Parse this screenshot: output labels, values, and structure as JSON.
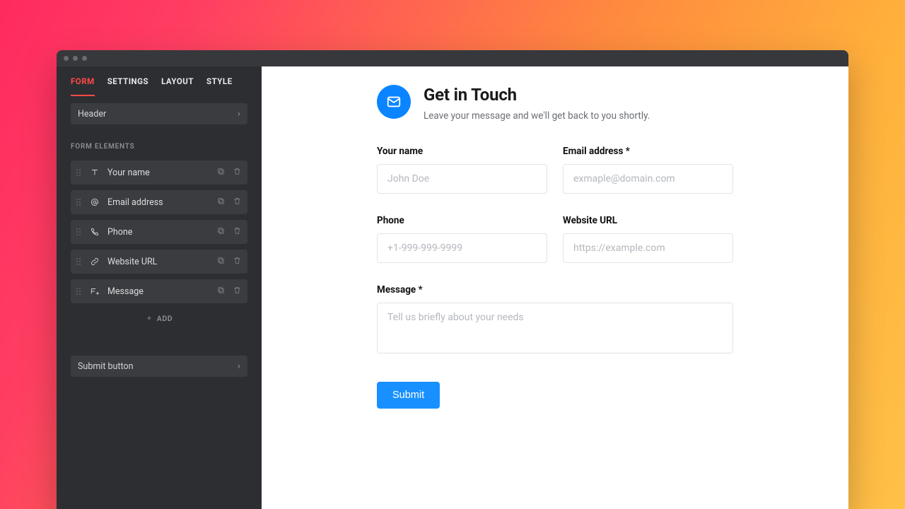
{
  "sidebar": {
    "tabs": [
      "FORM",
      "SETTINGS",
      "LAYOUT",
      "STYLE"
    ],
    "header_row": "Header",
    "elements_label": "FORM ELEMENTS",
    "items": [
      {
        "label": "Your name",
        "icon": "text"
      },
      {
        "label": "Email address",
        "icon": "at"
      },
      {
        "label": "Phone",
        "icon": "phone"
      },
      {
        "label": "Website URL",
        "icon": "link"
      },
      {
        "label": "Message",
        "icon": "textarea"
      }
    ],
    "add_label": "ADD",
    "submit_row": "Submit button"
  },
  "form": {
    "title": "Get in Touch",
    "subtitle": "Leave your message and we'll get back to you shortly.",
    "fields": {
      "name": {
        "label": "Your name",
        "placeholder": "John Doe"
      },
      "email": {
        "label": "Email address *",
        "placeholder": "exmaple@domain.com"
      },
      "phone": {
        "label": "Phone",
        "placeholder": "+1-999-999-9999"
      },
      "url": {
        "label": "Website URL",
        "placeholder": "https://example.com"
      },
      "message": {
        "label": "Message *",
        "placeholder": "Tell us briefly about your needs"
      }
    },
    "submit": "Submit"
  }
}
